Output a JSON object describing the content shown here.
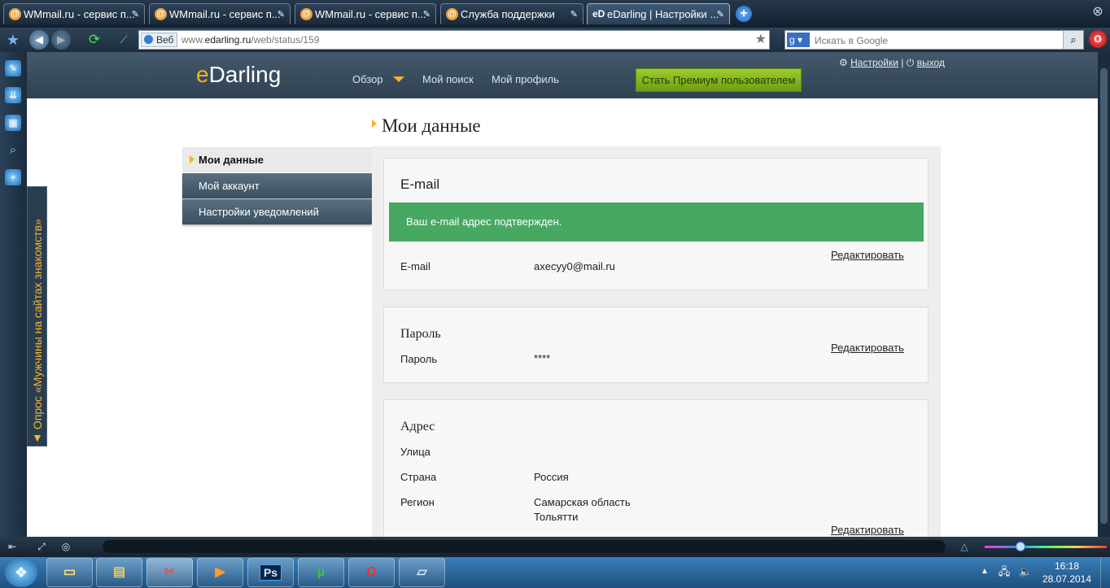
{
  "browser": {
    "tabs": [
      {
        "label": "WMmail.ru - сервис п...",
        "favicon": "at-icon"
      },
      {
        "label": "WMmail.ru - сервис п...",
        "favicon": "at-icon"
      },
      {
        "label": "WMmail.ru - сервис п...",
        "favicon": "at-icon"
      },
      {
        "label": "Служба поддержки",
        "favicon": "at-icon"
      },
      {
        "label": "eDarling | Настройки ...",
        "favicon": "eD",
        "active": true
      }
    ],
    "search_tag": "Веб",
    "url_prefix": "www.",
    "url_domain": "edarling.ru",
    "url_path": "/web/status/159",
    "search_placeholder": "Искать в Google",
    "search_engine": "g"
  },
  "sidebar": {
    "poll_text": "▲ Опрос «Мужчины на сайтах знакомств»"
  },
  "site": {
    "logo_e": "e",
    "logo_rest": "Darling",
    "nav": [
      "Обзор",
      "Мой поиск",
      "Мой профиль"
    ],
    "premium_label": "Стать Премиум пользователем",
    "settings_link": "Настройки",
    "logout_link": "выход",
    "accent_color": "#f4b51d"
  },
  "page": {
    "title": "Мои данные",
    "left_nav": [
      {
        "label": "Мои данные",
        "active": true
      },
      {
        "label": "Мой аккаунт"
      },
      {
        "label": "Настройки уведомлений"
      }
    ],
    "email_section": {
      "heading": "E-mail",
      "success_message": "Ваш e-mail адрес подтвержден.",
      "label": "E-mail",
      "value": "axecyy0@mail.ru",
      "edit": "Редактировать",
      "success_color": "#47a862"
    },
    "password_section": {
      "heading": "Пароль",
      "label": "Пароль",
      "value": "****",
      "edit": "Редактировать"
    },
    "address_section": {
      "heading": "Адрес",
      "street_label": "Улица",
      "street_value": "",
      "country_label": "Страна",
      "country_value": "Россия",
      "region_label": "Регион",
      "region_value": "Самарская область",
      "city_value": "Тольятти",
      "edit": "Редактировать"
    }
  },
  "taskbar": {
    "time": "16:18",
    "date": "28.07.2014",
    "apps": [
      "explorer",
      "files",
      "paint",
      "media",
      "Ps",
      "utorrent",
      "opera",
      "notepad"
    ]
  }
}
